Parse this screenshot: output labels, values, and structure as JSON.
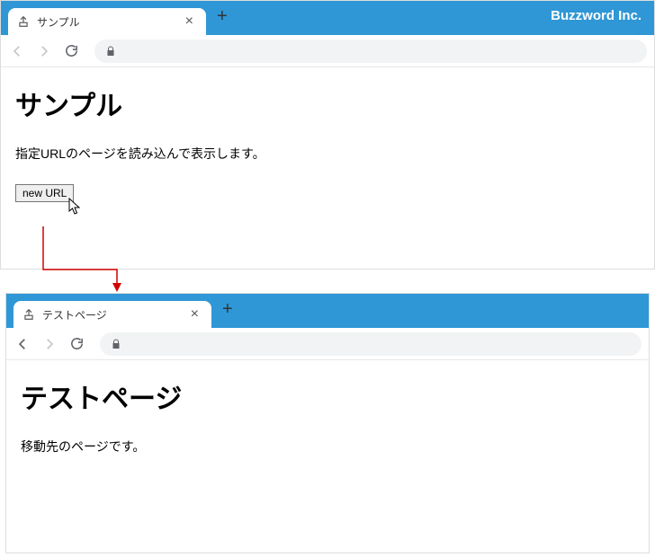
{
  "brand": "Buzzword Inc.",
  "browser1": {
    "tab_title": "サンプル",
    "heading": "サンプル",
    "paragraph": "指定URLのページを読み込んで表示します。",
    "button_label": "new URL"
  },
  "browser2": {
    "tab_title": "テストページ",
    "heading": "テストページ",
    "paragraph": "移動先のページです。"
  }
}
